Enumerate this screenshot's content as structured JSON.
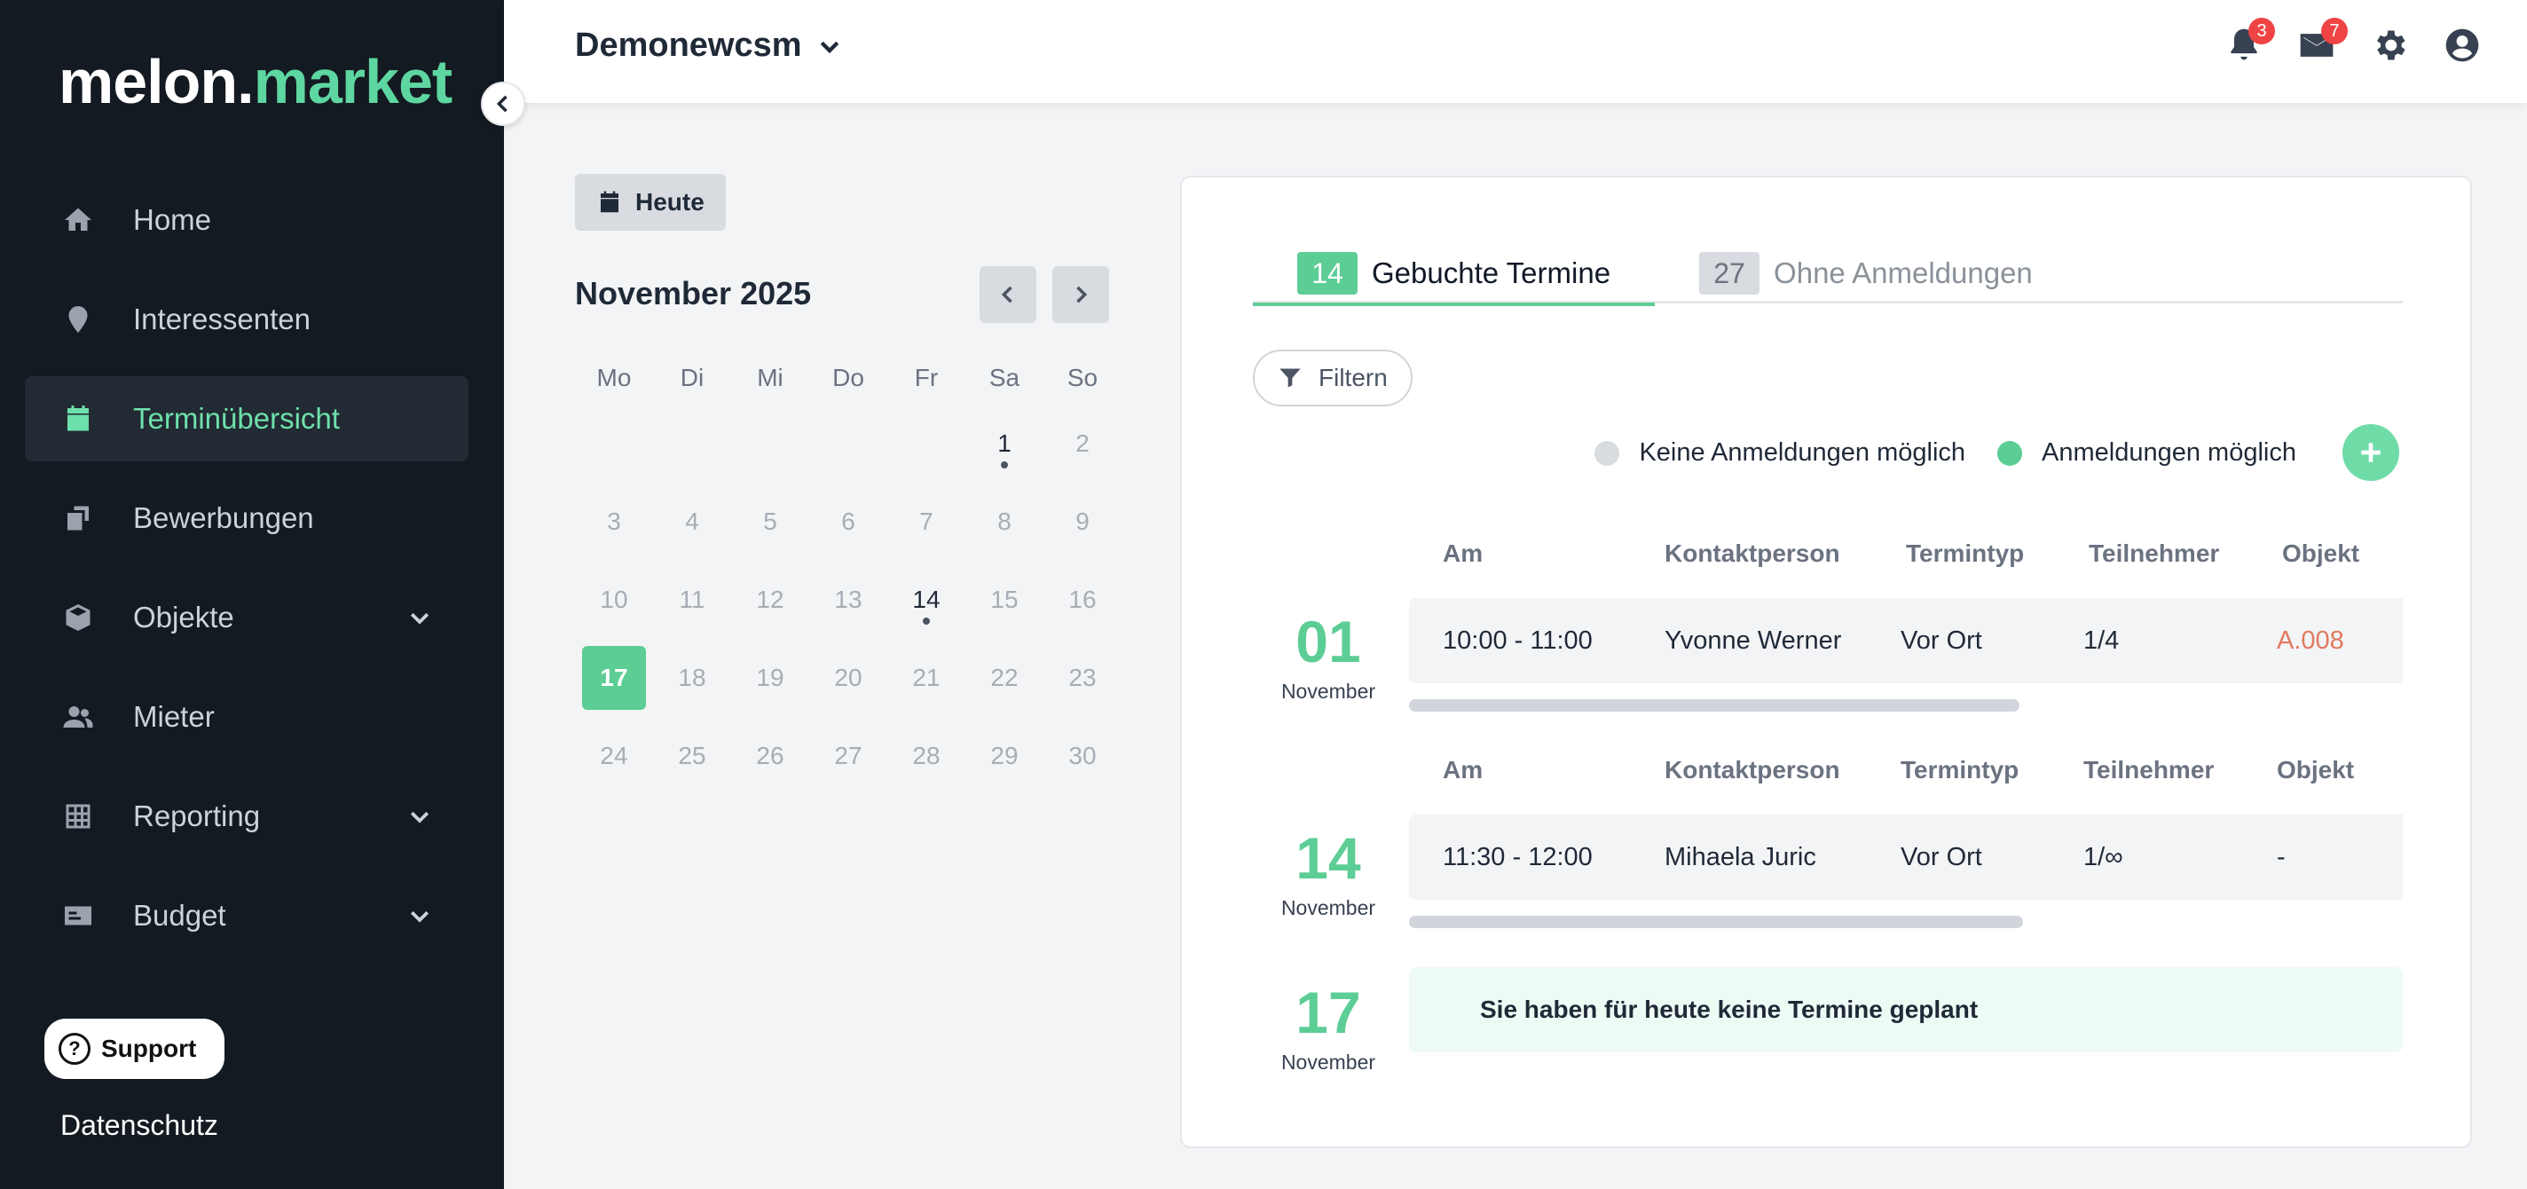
{
  "brand": {
    "name_main": "melon.",
    "name_accent": "market"
  },
  "sidebar": {
    "items": [
      {
        "label": "Home",
        "icon": "home-icon",
        "active": false,
        "expandable": false
      },
      {
        "label": "Interessenten",
        "icon": "map-pin-icon",
        "active": false,
        "expandable": false
      },
      {
        "label": "Terminübersicht",
        "icon": "calendar-icon",
        "active": true,
        "expandable": false
      },
      {
        "label": "Bewerbungen",
        "icon": "copy-icon",
        "active": false,
        "expandable": false
      },
      {
        "label": "Objekte",
        "icon": "box-icon",
        "active": false,
        "expandable": true
      },
      {
        "label": "Mieter",
        "icon": "users-icon",
        "active": false,
        "expandable": false
      },
      {
        "label": "Reporting",
        "icon": "table-icon",
        "active": false,
        "expandable": true
      },
      {
        "label": "Budget",
        "icon": "money-card-icon",
        "active": false,
        "expandable": true
      }
    ],
    "support_label": "Support",
    "privacy_label": "Datenschutz"
  },
  "header": {
    "org_name": "Demonewcsm",
    "notifications_count": "3",
    "messages_count": "7"
  },
  "calendar": {
    "today_label": "Heute",
    "month_title": "November 2025",
    "weekdays": [
      "Mo",
      "Di",
      "Mi",
      "Do",
      "Fr",
      "Sa",
      "So"
    ],
    "leading_blanks": 5,
    "days": [
      1,
      2,
      3,
      4,
      5,
      6,
      7,
      8,
      9,
      10,
      11,
      12,
      13,
      14,
      15,
      16,
      17,
      18,
      19,
      20,
      21,
      22,
      23,
      24,
      25,
      26,
      27,
      28,
      29,
      30
    ],
    "event_days": [
      1,
      14
    ],
    "today": 17
  },
  "appointments": {
    "tabs": [
      {
        "count": "14",
        "label": "Gebuchte Termine",
        "active": true
      },
      {
        "count": "27",
        "label": "Ohne Anmeldungen",
        "active": false
      }
    ],
    "filter_label": "Filtern",
    "legend": [
      {
        "label": "Keine Anmeldungen möglich",
        "color": "#d9dcdf"
      },
      {
        "label": "Anmeldungen möglich",
        "color": "#5ccd95"
      }
    ],
    "columns": [
      "Am",
      "Kontaktperson",
      "Termintyp",
      "Teilnehmer",
      "Objekt"
    ],
    "groups": [
      {
        "day": "01",
        "month": "November",
        "row": {
          "time": "10:00 - 11:00",
          "contact": "Yvonne Werner",
          "type": "Vor Ort",
          "participants": "1/4",
          "object": "A.008"
        }
      },
      {
        "day": "14",
        "month": "November",
        "row": {
          "time": "11:30 - 12:00",
          "contact": "Mihaela Juric",
          "type": "Vor Ort",
          "participants": "1/∞",
          "object": "-"
        }
      },
      {
        "day": "17",
        "month": "November",
        "empty_message": "Sie haben für heute keine Termine geplant"
      }
    ]
  },
  "colors": {
    "accent": "#5ccd95",
    "sidebar_bg": "#141a21",
    "link": "#e07a5f"
  }
}
